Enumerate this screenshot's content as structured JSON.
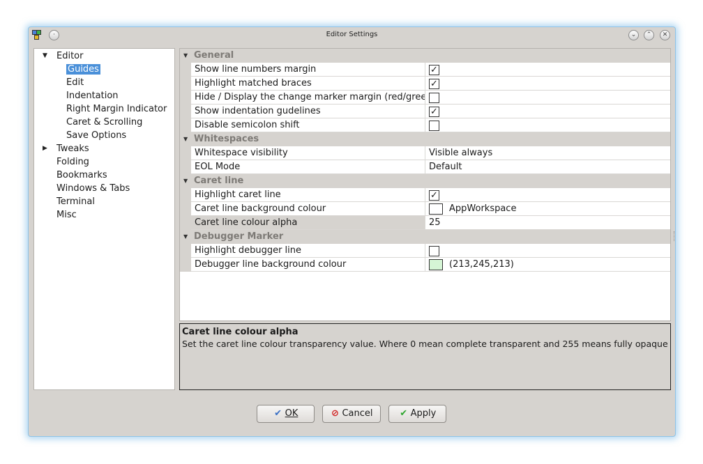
{
  "window": {
    "title": "Editor Settings",
    "controls": {
      "minimize": "⌄",
      "maximize": "⌃",
      "close": "✕"
    }
  },
  "tree": {
    "items": [
      {
        "label": "Editor",
        "level": 0,
        "expanded": true
      },
      {
        "label": "Guides",
        "level": 1,
        "selected": true
      },
      {
        "label": "Edit",
        "level": 1
      },
      {
        "label": "Indentation",
        "level": 1
      },
      {
        "label": "Right Margin Indicator",
        "level": 1
      },
      {
        "label": "Caret & Scrolling",
        "level": 1
      },
      {
        "label": "Save Options",
        "level": 1
      },
      {
        "label": "Tweaks",
        "level": 0,
        "expanded": false
      },
      {
        "label": "Folding",
        "level": 0
      },
      {
        "label": "Bookmarks",
        "level": 0
      },
      {
        "label": "Windows & Tabs",
        "level": 0
      },
      {
        "label": "Terminal",
        "level": 0
      },
      {
        "label": "Misc",
        "level": 0
      }
    ]
  },
  "settings": {
    "sections": [
      {
        "title": "General",
        "rows": [
          {
            "label": "Show line numbers margin",
            "type": "checkbox",
            "checked": true
          },
          {
            "label": "Highlight matched braces",
            "type": "checkbox",
            "checked": true
          },
          {
            "label": "Hide / Display the change marker margin (red/green",
            "type": "checkbox",
            "checked": false
          },
          {
            "label": "Show indentation gudelines",
            "type": "checkbox",
            "checked": true
          },
          {
            "label": "Disable semicolon shift",
            "type": "checkbox",
            "checked": false
          }
        ]
      },
      {
        "title": "Whitespaces",
        "rows": [
          {
            "label": "Whitespace visibility",
            "type": "text",
            "value": "Visible always"
          },
          {
            "label": "EOL Mode",
            "type": "text",
            "value": "Default"
          }
        ]
      },
      {
        "title": "Caret line",
        "rows": [
          {
            "label": "Highlight caret line",
            "type": "checkbox",
            "checked": true
          },
          {
            "label": "Caret line background colour",
            "type": "color",
            "color": "#ffffff",
            "value": "AppWorkspace"
          },
          {
            "label": "Caret line colour alpha",
            "type": "text",
            "value": "25",
            "highlighted": true
          }
        ]
      },
      {
        "title": "Debugger Marker",
        "rows": [
          {
            "label": "Highlight debugger line",
            "type": "checkbox",
            "checked": false
          },
          {
            "label": "Debugger line background colour",
            "type": "color",
            "color": "#d5f5d5",
            "value": "(213,245,213)"
          }
        ]
      }
    ]
  },
  "description": {
    "title": "Caret line colour alpha",
    "body": "Set the caret line colour transparency value. Where 0 mean complete transparent and 255 means fully opaque"
  },
  "buttons": {
    "ok": {
      "icon": "✔",
      "label": "OK",
      "icon_color": "#3a6fc4"
    },
    "cancel": {
      "icon": "⊘",
      "label": "Cancel",
      "icon_color": "#d02020"
    },
    "apply": {
      "icon": "✔",
      "label": "Apply",
      "icon_color": "#2fa52f"
    }
  },
  "check_glyph": "✓"
}
